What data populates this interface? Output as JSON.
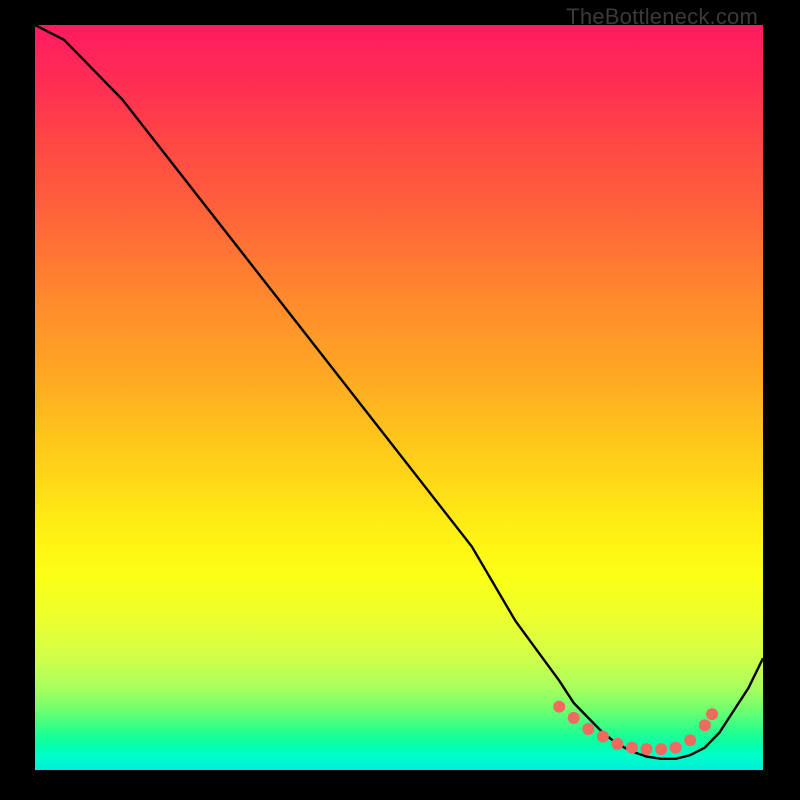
{
  "watermark": "TheBottleneck.com",
  "chart_data": {
    "type": "line",
    "title": "",
    "xlabel": "",
    "ylabel": "",
    "xlim": [
      0,
      100
    ],
    "ylim": [
      0,
      100
    ],
    "series": [
      {
        "name": "bottleneck-curve",
        "x": [
          0,
          4,
          8,
          12,
          16,
          20,
          24,
          28,
          32,
          36,
          40,
          44,
          48,
          52,
          56,
          60,
          63,
          66,
          69,
          72,
          74,
          76,
          78,
          80,
          82,
          84,
          86,
          88,
          90,
          92,
          94,
          96,
          98,
          100
        ],
        "y": [
          100,
          98,
          94,
          90,
          85,
          80,
          75,
          70,
          65,
          60,
          55,
          50,
          45,
          40,
          35,
          30,
          25,
          20,
          16,
          12,
          9,
          7,
          5,
          3.5,
          2.5,
          1.8,
          1.5,
          1.5,
          2,
          3,
          5,
          8,
          11,
          15
        ]
      }
    ],
    "markers": {
      "name": "optimum-band-dots",
      "x": [
        72,
        74,
        76,
        78,
        80,
        82,
        84,
        86,
        88,
        90,
        92,
        93
      ],
      "y": [
        8.5,
        7,
        5.5,
        4.5,
        3.5,
        3,
        2.8,
        2.8,
        3,
        4,
        6,
        7.5
      ]
    }
  }
}
